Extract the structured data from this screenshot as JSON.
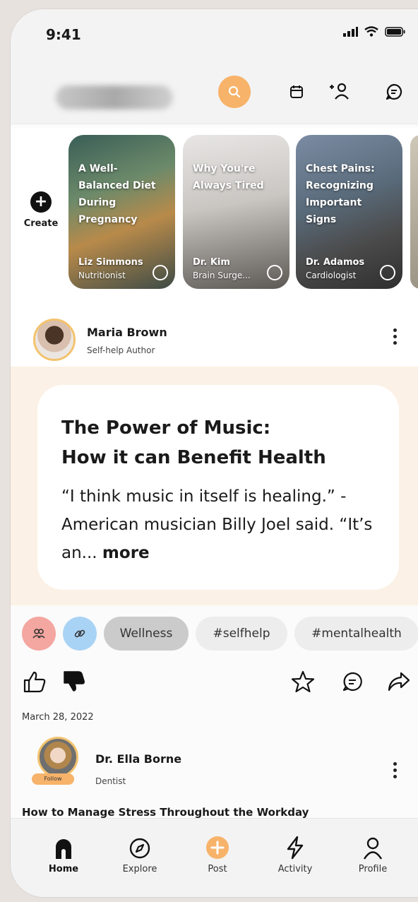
{
  "status": {
    "time": "9:41"
  },
  "header": {
    "icons": [
      "search-icon",
      "calendar-icon",
      "add-user-icon",
      "chat-icon"
    ],
    "accent": "#f7b36a"
  },
  "stories": {
    "create_label": "Create",
    "items": [
      {
        "title": "A Well-Balanced Diet During Pregnancy",
        "author": "Liz Simmons",
        "role": "Nutritionist"
      },
      {
        "title": "Why You're Always Tired",
        "author": "Dr. Kim",
        "role": "Brain Surge..."
      },
      {
        "title": "Chest Pains: Recognizing Important Signs",
        "author": "Dr. Adamos",
        "role": "Cardiologist"
      }
    ]
  },
  "post": {
    "author": "Maria Brown",
    "role": "Self-help Author",
    "title_line1": "The Power of Music:",
    "title_line2": "How it can Benefit Health",
    "excerpt": "“I think music in itself is healing.” - American musician Billy Joel said. “It’s an...",
    "more_label": "more",
    "tags": [
      "Wellness",
      "#selfhelp",
      "#mentalhealth"
    ],
    "date": "March 28, 2022"
  },
  "post2": {
    "author": "Dr. Ella Borne",
    "role": "Dentist",
    "follow_label": "Follow",
    "title": "How to Manage Stress Throughout the Workday"
  },
  "tabbar": {
    "items": [
      {
        "label": "Home",
        "icon": "home-icon"
      },
      {
        "label": "Explore",
        "icon": "compass-icon"
      },
      {
        "label": "Post",
        "icon": "plus-circle-icon"
      },
      {
        "label": "Activity",
        "icon": "lightning-icon"
      },
      {
        "label": "Profile",
        "icon": "person-icon"
      }
    ]
  }
}
